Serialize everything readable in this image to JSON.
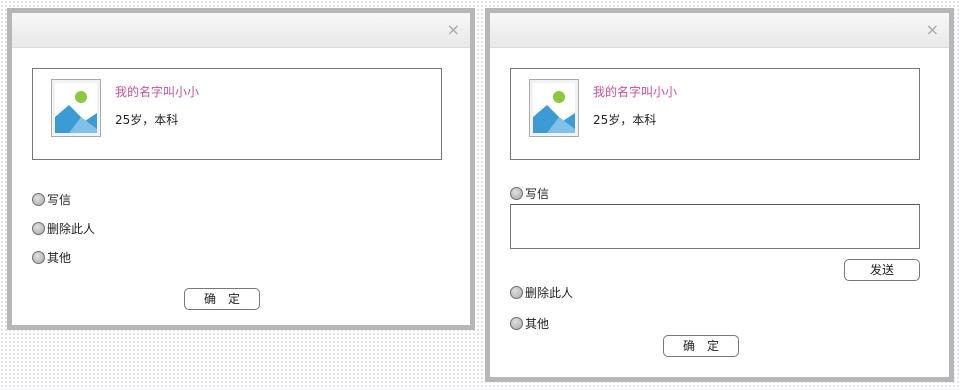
{
  "left_dialog": {
    "close_glyph": "×",
    "profile": {
      "avatar_icon": "image-placeholder-icon",
      "name": "我的名字叫小小",
      "info": "25岁，本科"
    },
    "options": [
      {
        "label": "写信"
      },
      {
        "label": "删除此人"
      },
      {
        "label": "其他"
      }
    ],
    "confirm_label": "确　定"
  },
  "right_dialog": {
    "close_glyph": "×",
    "profile": {
      "avatar_icon": "image-placeholder-icon",
      "name": "我的名字叫小小",
      "info": "25岁，本科"
    },
    "options": [
      {
        "label": "写信"
      },
      {
        "label": "删除此人"
      },
      {
        "label": "其他"
      }
    ],
    "message_value": "",
    "send_label": "发送",
    "confirm_label": "确　定"
  },
  "colors": {
    "name_color": "#d0509a",
    "dialog_border": "#b7b7b7",
    "background_dots": "#9a9ad0"
  }
}
